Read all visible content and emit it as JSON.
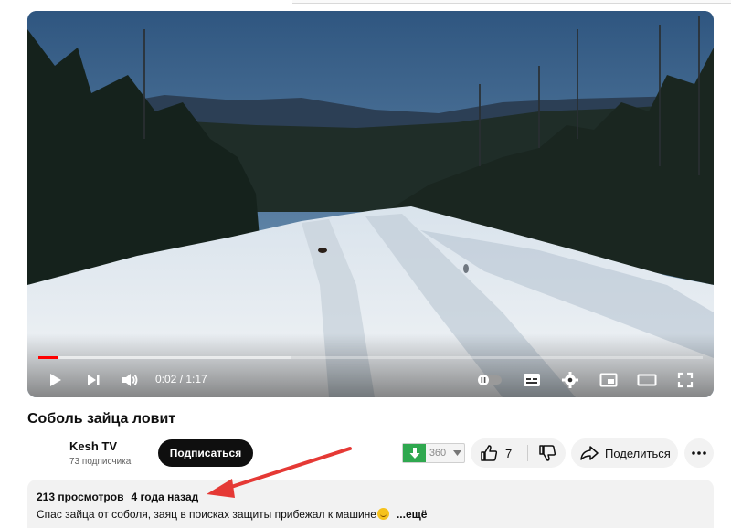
{
  "video": {
    "time_current": "0:02",
    "time_total": "1:17",
    "progress_played": 0.029,
    "progress_loaded": 0.38
  },
  "title": "Соболь зайца ловит",
  "channel": {
    "name": "Kesh TV",
    "subscribers": "73 подписчика",
    "subscribe_label": "Подписаться"
  },
  "download": {
    "count": "360"
  },
  "actions": {
    "likes": "7",
    "share_label": "Поделиться"
  },
  "description": {
    "views": "213 просмотров",
    "published": "4 года назад",
    "text": "Спас зайца от соболя, заяц в поисках защиты прибежал к машине",
    "more_label": "...ещё"
  },
  "colors": {
    "progress_played": "#ff0000",
    "subscribe_bg": "#0f0f0f",
    "download_green": "#2fa84f",
    "annotation_arrow": "#e53935"
  },
  "icons": [
    "play-icon",
    "next-icon",
    "volume-icon",
    "autoplay-toggle-icon",
    "subtitles-icon",
    "settings-icon",
    "miniplayer-icon",
    "theater-icon",
    "fullscreen-icon",
    "download-arrow-icon",
    "caret-down-icon",
    "thumbs-up-icon",
    "thumbs-down-icon",
    "share-icon",
    "more-dots-icon"
  ]
}
